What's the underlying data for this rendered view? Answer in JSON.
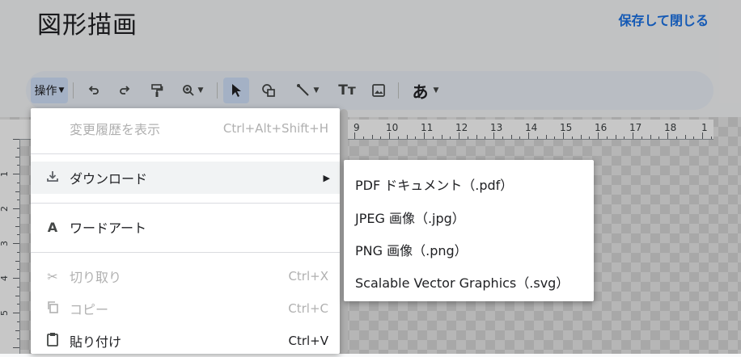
{
  "header": {
    "title": "図形描画",
    "save_close": "保存して閉じる"
  },
  "toolbar": {
    "ops_label": "操作",
    "text_label": "Tт",
    "font_label": "あ"
  },
  "ruler": {
    "h_numbers": [
      "9",
      "10",
      "11",
      "12",
      "13",
      "14",
      "15",
      "16",
      "17",
      "18",
      "1"
    ],
    "v_numbers": [
      "1",
      "2",
      "3",
      "4",
      "5"
    ]
  },
  "menu": {
    "history": {
      "label": "変更履歴を表示",
      "shortcut": "Ctrl+Alt+Shift+H"
    },
    "download": {
      "label": "ダウンロード"
    },
    "wordart": {
      "label": "ワードアート"
    },
    "cut": {
      "label": "切り取り",
      "shortcut": "Ctrl+X"
    },
    "copy": {
      "label": "コピー",
      "shortcut": "Ctrl+C"
    },
    "paste": {
      "label": "貼り付け",
      "shortcut": "Ctrl+V"
    }
  },
  "submenu": {
    "items": [
      "PDF ドキュメント（.pdf）",
      "JPEG 画像（.jpg）",
      "PNG 画像（.png）",
      "Scalable Vector Graphics（.svg）"
    ]
  },
  "colors": {
    "accent": "#1a73e8",
    "toolbar_bg": "#edf2fa",
    "selected_tool_bg": "#d3e3fd"
  }
}
